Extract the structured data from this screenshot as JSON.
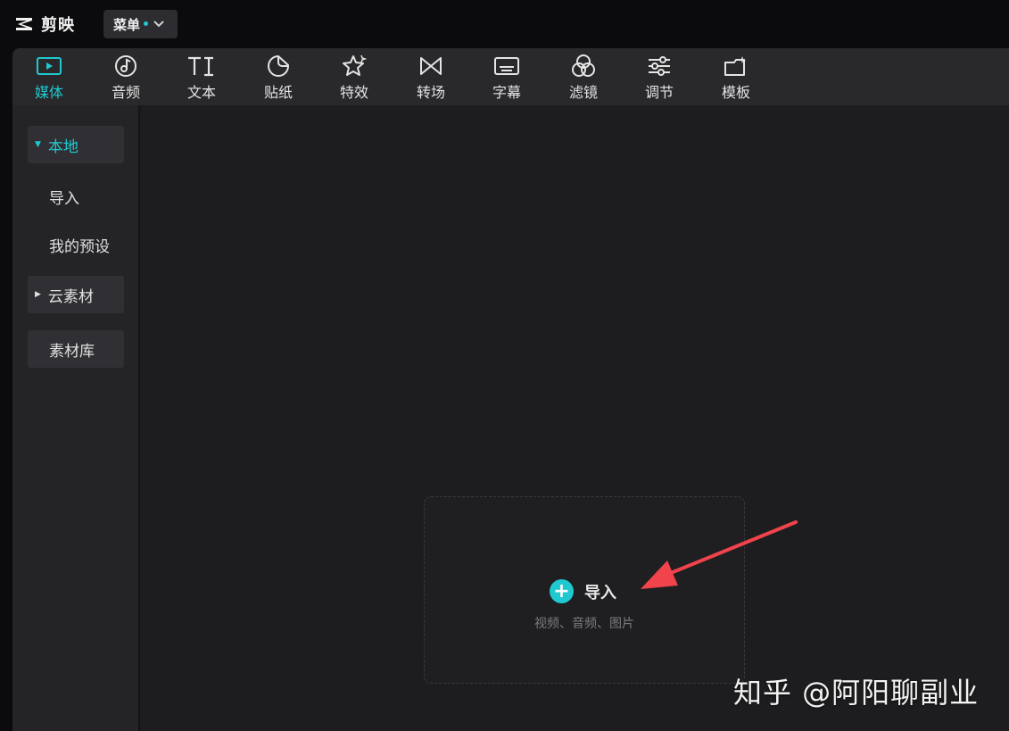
{
  "app": {
    "title": "剪映",
    "logo_icon": "capcut-logo-icon"
  },
  "menu": {
    "label": "菜单",
    "indicator_color": "#20c9d0"
  },
  "toolbar": {
    "items": [
      {
        "label": "媒体",
        "icon": "media-play-icon",
        "active": true
      },
      {
        "label": "音频",
        "icon": "music-note-icon",
        "active": false
      },
      {
        "label": "文本",
        "icon": "text-ti-icon",
        "active": false
      },
      {
        "label": "贴纸",
        "icon": "sticker-icon",
        "active": false
      },
      {
        "label": "特效",
        "icon": "effects-star-icon",
        "active": false
      },
      {
        "label": "转场",
        "icon": "transition-bowtie-icon",
        "active": false
      },
      {
        "label": "字幕",
        "icon": "subtitle-icon",
        "active": false
      },
      {
        "label": "滤镜",
        "icon": "filter-circles-icon",
        "active": false
      },
      {
        "label": "调节",
        "icon": "adjust-sliders-icon",
        "active": false
      },
      {
        "label": "模板",
        "icon": "template-icon",
        "active": false
      }
    ]
  },
  "sidebar": {
    "items": [
      {
        "label": "本地",
        "expanded": true,
        "active": true
      },
      {
        "label": "导入"
      },
      {
        "label": "我的预设"
      },
      {
        "label": "云素材",
        "expanded": false
      },
      {
        "label": "素材库"
      }
    ]
  },
  "dropzone": {
    "import_label": "导入",
    "hint": "视频、音频、图片"
  },
  "watermark": {
    "text": "知乎 @阿阳聊副业"
  },
  "colors": {
    "accent": "#20c9d0",
    "arrow": "#f0434b"
  }
}
